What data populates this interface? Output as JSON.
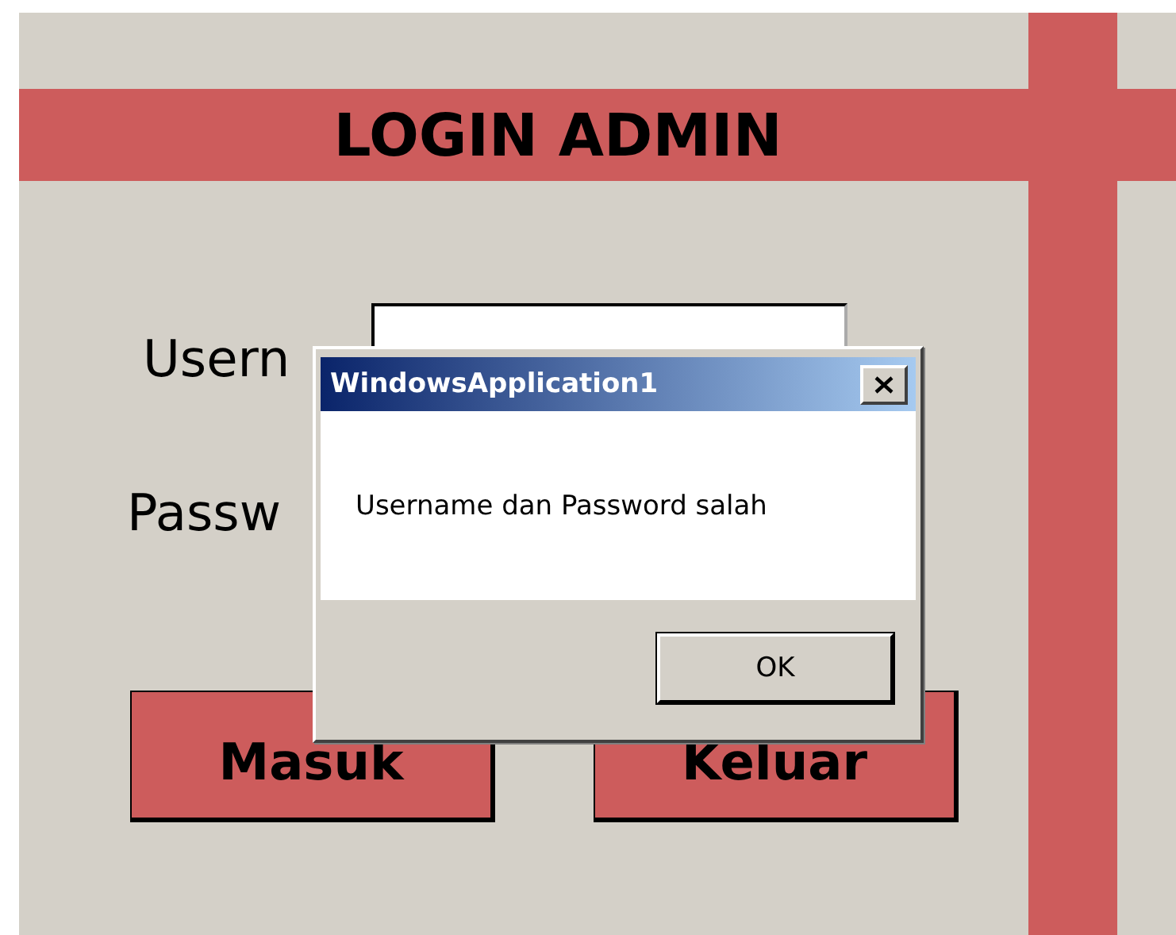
{
  "form": {
    "title": "LOGIN ADMIN"
  },
  "fields": [
    {
      "label": "Usern"
    },
    {
      "label": "Passw"
    }
  ],
  "buttons": [
    "Masuk",
    "Keluar"
  ],
  "dialog": {
    "title": "WindowsApplication1",
    "message": "Username dan Password salah",
    "buttons": [
      "OK"
    ]
  }
}
